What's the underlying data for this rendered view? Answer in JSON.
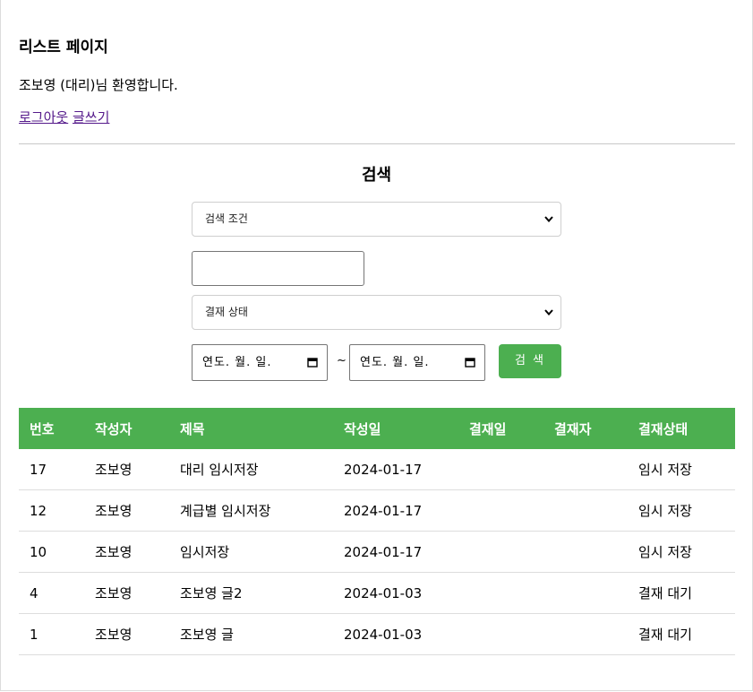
{
  "header": {
    "title": "리스트 페이지",
    "welcome": "조보영 (대리)님 환영합니다.",
    "logout_link": "로그아웃",
    "write_link": "글쓰기"
  },
  "search": {
    "title": "검색",
    "condition_select": "검색 조건",
    "keyword_value": "",
    "status_select": "결재 상태",
    "date_from": "연도. 월. 일.",
    "date_separator": "~",
    "date_to": "연도. 월. 일.",
    "submit_label": "검 색"
  },
  "table": {
    "columns": [
      "번호",
      "작성자",
      "제목",
      "작성일",
      "결재일",
      "결재자",
      "결재상태"
    ],
    "rows": [
      [
        "17",
        "조보영",
        "대리 임시저장",
        "2024-01-17",
        "",
        "",
        "임시 저장"
      ],
      [
        "12",
        "조보영",
        "계급별 임시저장",
        "2024-01-17",
        "",
        "",
        "임시 저장"
      ],
      [
        "10",
        "조보영",
        "임시저장",
        "2024-01-17",
        "",
        "",
        "임시 저장"
      ],
      [
        "4",
        "조보영",
        "조보영 글2",
        "2024-01-03",
        "",
        "",
        "결재 대기"
      ],
      [
        "1",
        "조보영",
        "조보영 글",
        "2024-01-03",
        "",
        "",
        "결재 대기"
      ]
    ]
  },
  "colors": {
    "accent": "#4caf50",
    "visited_link": "#551a8b"
  }
}
